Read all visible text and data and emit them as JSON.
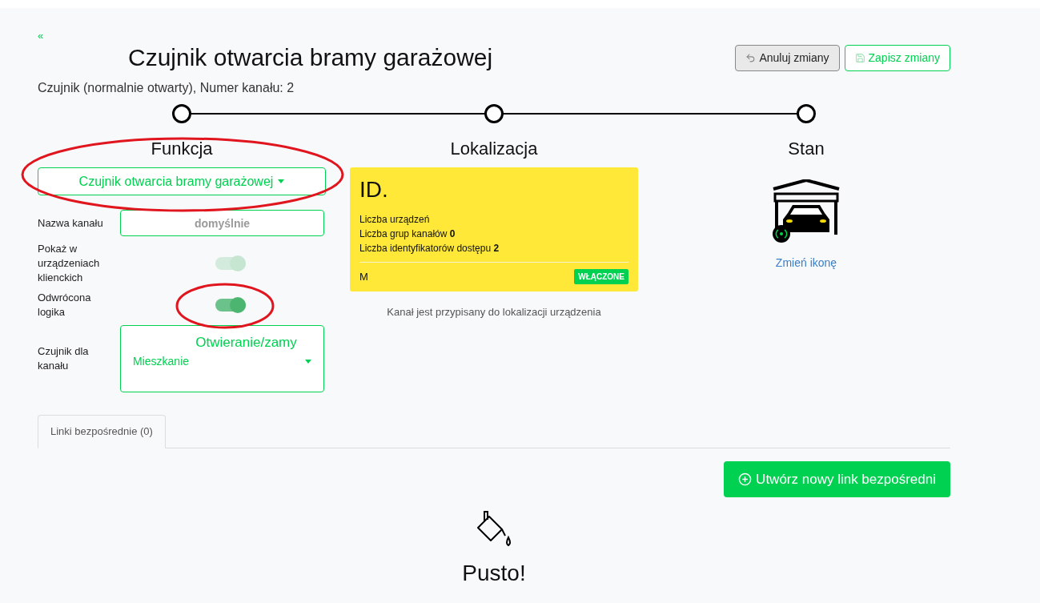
{
  "back_link": "«",
  "title": "Czujnik otwarcia bramy garażowej",
  "actions": [
    {
      "kind": "cancel",
      "label": "Anuluj zmiany"
    },
    {
      "kind": "save",
      "label": "Zapisz zmiany"
    }
  ],
  "subtitle": "Czujnik (normalnie otwarty), Numer kanału: 2",
  "steps": [
    {
      "label": "Funkcja"
    },
    {
      "label": "Lokalizacja"
    },
    {
      "label": "Stan"
    }
  ],
  "function_select": "Czujnik otwarcia bramy garażowej",
  "form": [
    {
      "kind": "text",
      "label": "Nazwa kanału",
      "placeholder": "domyślnie"
    },
    {
      "kind": "toggle",
      "label": "Pokaż w urządzeniach klienckich",
      "on": true,
      "disabled": true
    },
    {
      "kind": "toggle",
      "label": "Odwrócona logika",
      "on": true,
      "disabled": false
    },
    {
      "kind": "select",
      "label": "Czujnik dla kanału",
      "lines": [
        "Otwieranie/zamy",
        "Mieszkanie"
      ]
    }
  ],
  "location": {
    "id": "ID.",
    "stats": [
      "Liczba urządzeń",
      "Liczba grup kanałów **0**",
      "Liczba identyfikatorów dostępu **2**"
    ],
    "footer": "M",
    "badge": "WŁĄCZONE",
    "note": "Kanał jest przypisany do lokalizacji urządzenia"
  },
  "state": {
    "link": "Zmień ikonę"
  },
  "tabs": [
    {
      "label": "Linki bezpośrednie (0)",
      "selected": true
    }
  ],
  "create_button": "Utwórz nowy link bezpośredni",
  "empty": "Pusto!",
  "annotations": [
    {
      "kind": "ellipse"
    },
    {
      "kind": "ellipse"
    }
  ]
}
